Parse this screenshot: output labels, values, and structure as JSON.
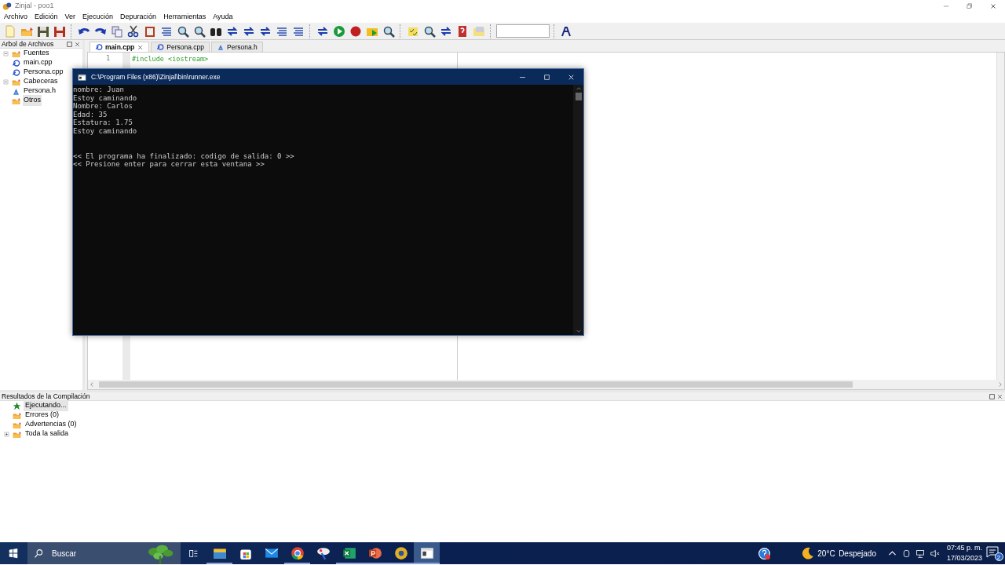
{
  "app_window": {
    "title": "Zinjal - poo1"
  },
  "menu": [
    "Archivo",
    "Edición",
    "Ver",
    "Ejecución",
    "Depuración",
    "Herramientas",
    "Ayuda"
  ],
  "file_tree": {
    "title": "Arbol de Archivos",
    "items": [
      {
        "label": "Fuentes",
        "kind": "folder",
        "expanded": true,
        "selected": false,
        "children": [
          {
            "label": "main.cpp",
            "kind": "source",
            "selected": false
          },
          {
            "label": "Persona.cpp",
            "kind": "source",
            "selected": false
          }
        ]
      },
      {
        "label": "Cabeceras",
        "kind": "folder",
        "expanded": true,
        "selected": false,
        "children": [
          {
            "label": "Persona.h",
            "kind": "header",
            "selected": false
          }
        ]
      },
      {
        "label": "Otros",
        "kind": "folder",
        "selected": true
      }
    ]
  },
  "editor": {
    "tabs": [
      {
        "label": "main.cpp",
        "kind": "source",
        "selected": true
      },
      {
        "label": "Persona.cpp",
        "kind": "source",
        "selected": false
      },
      {
        "label": "Persona.h",
        "kind": "header",
        "selected": false
      }
    ],
    "lines": [
      {
        "number": "1",
        "code": "#include <iostream>"
      }
    ]
  },
  "console": {
    "title": "C:\\Program Files (x86)\\Zinjal\\bin\\runner.exe",
    "output": [
      "nombre: Juan",
      "Estoy caminando",
      "Nombre: Carlos",
      "Edad: 35",
      "Estatura: 1.75",
      "Estoy caminando"
    ],
    "footer": [
      "<< El programa ha finalizado: codigo de salida: 0 >>",
      "<< Presione enter para cerrar esta ventana >>"
    ]
  },
  "results": {
    "title": "Resultados de la Compilación",
    "items": [
      {
        "label": "Ejecutando...",
        "kind": "status",
        "selected": true
      },
      {
        "label": "Errores (0)",
        "kind": "folder",
        "selected": false
      },
      {
        "label": "Advertencias (0)",
        "kind": "folder",
        "selected": false
      },
      {
        "label": "Toda la salida",
        "kind": "folder",
        "selected": false,
        "expanded": false
      }
    ]
  },
  "taskbar": {
    "search": {
      "placeholder": "Buscar"
    },
    "apps": [
      {
        "kind": "explorer",
        "running": true,
        "active": false
      },
      {
        "kind": "store",
        "running": false,
        "active": false
      },
      {
        "kind": "mail",
        "running": false,
        "active": false
      },
      {
        "kind": "chrome",
        "running": true,
        "active": false
      },
      {
        "kind": "paint",
        "running": false,
        "active": false
      },
      {
        "kind": "excel",
        "running": true,
        "active": false
      },
      {
        "kind": "powerpoint",
        "running": true,
        "active": false
      },
      {
        "kind": "zinjal",
        "running": true,
        "active": false
      },
      {
        "kind": "console",
        "running": true,
        "active": true
      }
    ],
    "weather": {
      "temperature": "20°C",
      "condition": "Despejado"
    },
    "clock": {
      "time": "07:45 p. m.",
      "date": "17/03/2023"
    },
    "notifications": "2"
  }
}
